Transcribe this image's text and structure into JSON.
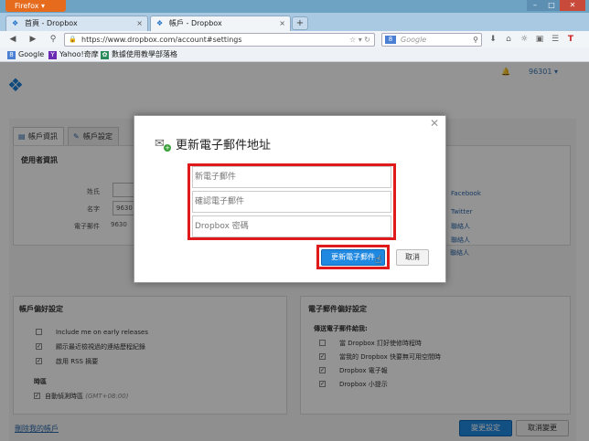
{
  "browser": {
    "menu_label": "Firefox ▾",
    "tabs": [
      {
        "title": "首頁 - Dropbox"
      },
      {
        "title": "帳戶 - Dropbox"
      }
    ],
    "new_tab": "+",
    "url": "https://www.dropbox.com/account#settings",
    "search_placeholder": "Google",
    "search_engine_letter": "8",
    "bookmarks": [
      "Google",
      "Yahoo!奇摩",
      "數據使用教學部落格"
    ]
  },
  "header": {
    "user": "96301 ▾"
  },
  "account_tabs": [
    "帳戶資訊",
    "帳戶設定"
  ],
  "user_info": {
    "title": "使用者資訊",
    "fields": [
      {
        "label": "姓氏",
        "value": ""
      },
      {
        "label": "名字",
        "value": "9630"
      },
      {
        "label": "電子郵件",
        "value": "9630"
      }
    ],
    "links": [
      "Facebook",
      "Twitter",
      "聯絡人",
      "聯絡人",
      "聯絡人"
    ]
  },
  "account_prefs": {
    "title": "帳戶偏好設定",
    "options": [
      {
        "label": "Include me on early releases",
        "checked": false
      },
      {
        "label": "顯示最近檢視過的連結歷程紀錄",
        "checked": true
      },
      {
        "label": "啟用 RSS 摘要",
        "checked": true
      }
    ],
    "timezone_title": "時區",
    "timezone_option": {
      "label": "自動偵測時區",
      "detail": "(GMT+08:00)",
      "checked": true
    }
  },
  "email_prefs": {
    "title": "電子郵件偏好設定",
    "subtitle": "傳送電子郵件給我:",
    "options": [
      {
        "label": "當 Dropbox 訂好使修時程時",
        "checked": false
      },
      {
        "label": "當我的 Dropbox 快要無可用空間時",
        "checked": true
      },
      {
        "label": "Dropbox 電子報",
        "checked": true
      },
      {
        "label": "Dropbox 小提示",
        "checked": true
      }
    ]
  },
  "footer": {
    "delete_link": "刪除我的帳戶",
    "save_label": "變更設定",
    "cancel_label": "取消變更"
  },
  "modal": {
    "title": "更新電子郵件地址",
    "new_email_placeholder": "新電子郵件",
    "confirm_email_placeholder": "確認電子郵件",
    "password_placeholder": "Dropbox 密碼",
    "submit_label": "更新電子郵件",
    "cancel_label": "取消",
    "close_glyph": "✕"
  }
}
